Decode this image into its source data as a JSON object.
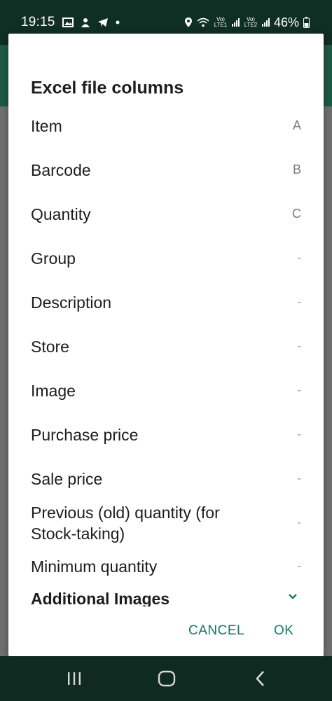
{
  "status_bar": {
    "time": "19:15",
    "battery": "46%",
    "lte1": "Vo) LTE1",
    "lte2": "Vo) LTE2",
    "left_icons": [
      "gallery-icon",
      "game-icon",
      "telegram-icon",
      "dot-icon"
    ],
    "right_icons": [
      "location-icon",
      "wifi-icon",
      "signal-icon",
      "battery-icon"
    ]
  },
  "dialog": {
    "title": "Excel file columns",
    "rows": [
      {
        "label": "Item",
        "value": "A"
      },
      {
        "label": "Barcode",
        "value": "B"
      },
      {
        "label": "Quantity",
        "value": "C"
      },
      {
        "label": "Group",
        "value": "-"
      },
      {
        "label": "Description",
        "value": "-"
      },
      {
        "label": "Store",
        "value": "-"
      },
      {
        "label": "Image",
        "value": "-"
      },
      {
        "label": "Purchase price",
        "value": "-"
      },
      {
        "label": "Sale price",
        "value": "-"
      },
      {
        "label": "Previous (old) quantity (for Stock-taking)",
        "value": "-"
      },
      {
        "label": "Minimum quantity",
        "value": "-"
      }
    ],
    "additional_images_label": "Additional Images",
    "cancel_label": "CANCEL",
    "ok_label": "OK"
  },
  "colors": {
    "accent": "#167a62",
    "status_bar_bg": "#0f2e24",
    "nav_bar_bg": "#0f2a20"
  }
}
